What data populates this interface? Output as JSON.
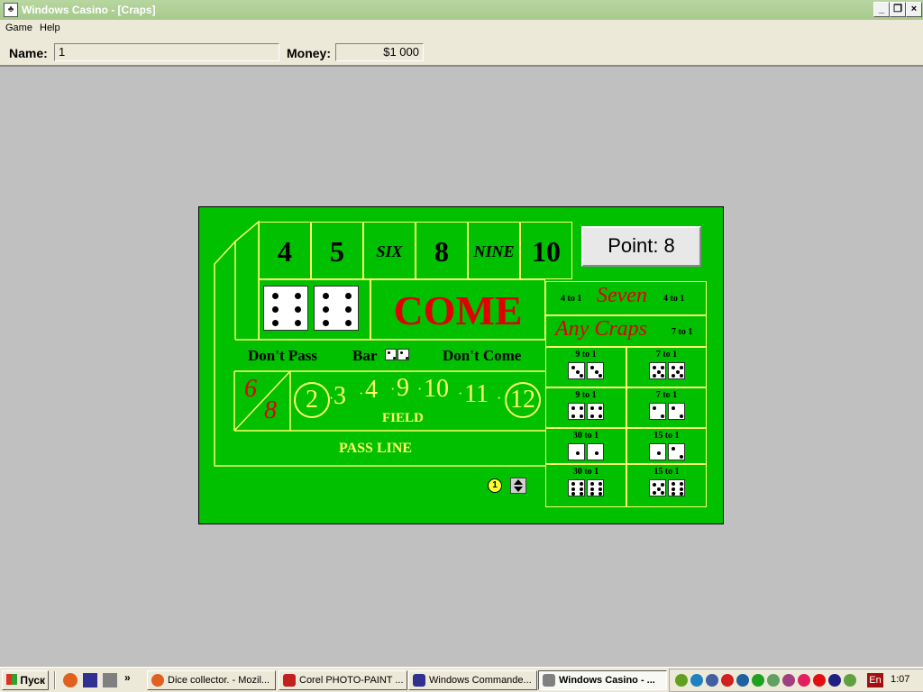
{
  "window": {
    "title": "Windows Casino - [Craps]"
  },
  "menu": [
    "Game",
    "Help"
  ],
  "player": {
    "name_label": "Name:",
    "name_value": "1",
    "money_label": "Money:",
    "money_value": "$1 000"
  },
  "table": {
    "place_numbers": [
      "4",
      "5",
      "SIX",
      "8",
      "NINE",
      "10"
    ],
    "point_label": "Point: 8",
    "come": "COME",
    "dont_pass": "Don't Pass",
    "bar": "Bar",
    "dont_come": "Don't Come",
    "big_six": "6",
    "big_eight": "8",
    "field_numbers": [
      "2",
      "3",
      "4",
      "9",
      "10",
      "11",
      "12"
    ],
    "field": "FIELD",
    "pass_line": "PASS LINE",
    "seven_left_odds": "4 to 1",
    "seven": "Seven",
    "seven_right_odds": "4 to 1",
    "any_craps": "Any Craps",
    "any_craps_odds": "7 to 1",
    "hardways": [
      {
        "odds": "9 to 1",
        "dice": [
          3,
          3
        ]
      },
      {
        "odds": "7 to 1",
        "dice": [
          5,
          5
        ]
      },
      {
        "odds": "9 to 1",
        "dice": [
          4,
          4
        ]
      },
      {
        "odds": "7 to 1",
        "dice": [
          2,
          2
        ]
      },
      {
        "odds": "30 to 1",
        "dice": [
          1,
          1
        ]
      },
      {
        "odds": "15 to 1",
        "dice": [
          1,
          2
        ]
      },
      {
        "odds": "30 to 1",
        "dice": [
          6,
          6
        ]
      },
      {
        "odds": "15 to 1",
        "dice": [
          5,
          6
        ]
      }
    ],
    "rolled_dice": [
      6,
      6
    ],
    "chip_value": "1"
  },
  "taskbar": {
    "start": "Пуск",
    "tasks": [
      {
        "label": "Dice collector. - Mozil...",
        "color": "#e06020"
      },
      {
        "label": "Corel PHOTO-PAINT ...",
        "color": "#c02020"
      },
      {
        "label": "Windows Commande...",
        "color": "#303090"
      },
      {
        "label": "Windows Casino - ...",
        "color": "#808080"
      }
    ],
    "language": "En",
    "clock": "1:07"
  }
}
